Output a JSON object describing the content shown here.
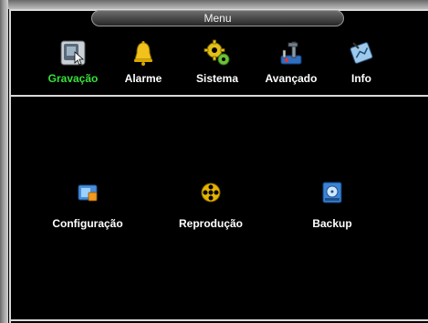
{
  "window": {
    "title": "Menu"
  },
  "tabs": [
    {
      "label": "Gravação",
      "icon": "recording-icon",
      "active": true
    },
    {
      "label": "Alarme",
      "icon": "bell-icon",
      "active": false
    },
    {
      "label": "Sistema",
      "icon": "gears-icon",
      "active": false
    },
    {
      "label": "Avançado",
      "icon": "tools-icon",
      "active": false
    },
    {
      "label": "Info",
      "icon": "info-icon",
      "active": false
    }
  ],
  "submenu": [
    {
      "label": "Configuração",
      "icon": "record-config-icon"
    },
    {
      "label": "Reprodução",
      "icon": "film-reel-icon"
    },
    {
      "label": "Backup",
      "icon": "backup-disk-icon"
    }
  ],
  "colors": {
    "active_tab": "#37e03a",
    "text": "#ffffff",
    "background": "#000000"
  }
}
